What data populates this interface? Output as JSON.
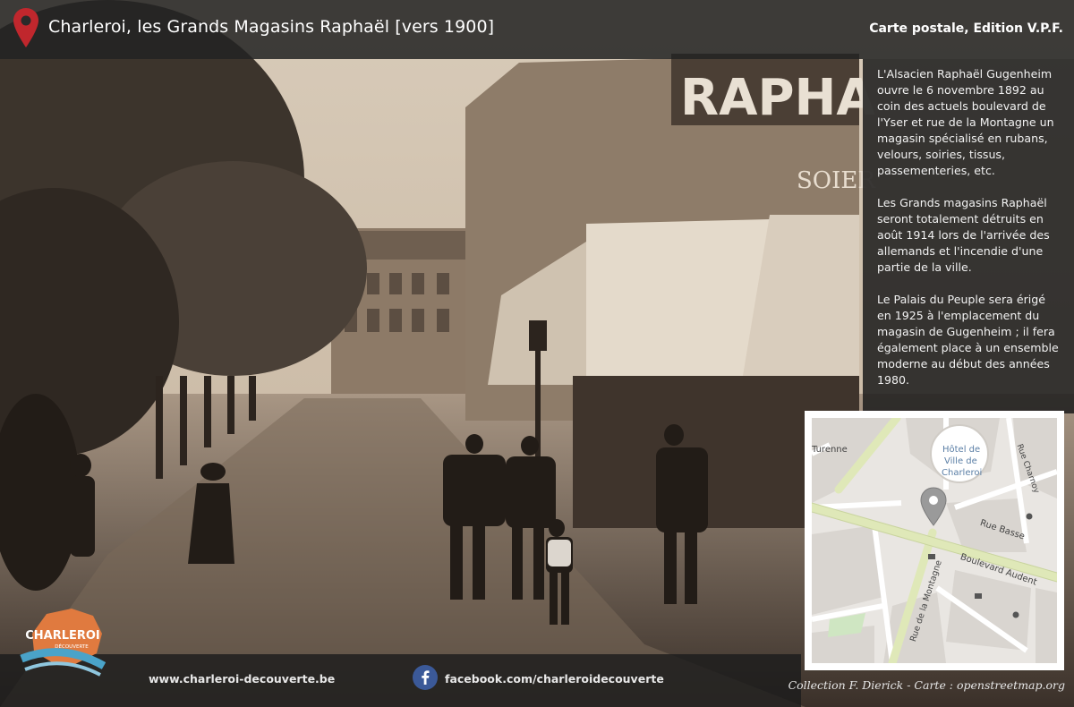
{
  "header": {
    "title": "Charleroi, les Grands Magasins Raphaël [vers 1900]",
    "credit": "Carte postale, Edition V.P.F."
  },
  "photo": {
    "shop_sign": "RAPHA",
    "awning_text": "SOIER"
  },
  "panel": {
    "paragraphs": [
      "L'Alsacien Raphaël Gugenheim ouvre le 6 novembre 1892 au coin des actuels boulevard de l'Yser et rue de la Montagne un magasin spécialisé en rubans, velours, soiries, tissus, passementeries, etc.",
      "Les Grands magasins Raphaël seront totalement détruits en août 1914 lors de l'arrivée des allemands et l'incendie d'une partie de la ville.",
      "Le Palais du Peuple sera érigé en 1925 à l'emplacement du magasin de Gugenheim ; il fera également place à un ensemble moderne au début des années 1980."
    ]
  },
  "map": {
    "labels": {
      "hotel_line1": "Hôtel de",
      "hotel_line2": "Ville de",
      "hotel_line3": "Charleroi",
      "turenne": "Turenne",
      "charnoy": "Rue Charnoy",
      "basse": "Rue Basse",
      "boulevard": "Boulevard Audent",
      "montagne": "Rue de la Montagne"
    },
    "colors": {
      "road_major": "#dfe8b8",
      "road_minor": "#ffffff",
      "block": "#d9d5d0",
      "park": "#cfe6c2"
    }
  },
  "logo": {
    "line1": "CHARLEROI",
    "line2": "DÉCOUVERTE"
  },
  "footer": {
    "site": "www.charleroi-decouverte.be",
    "facebook": "facebook.com/charleroidecouverte",
    "credit": "Collection F. Dierick - Carte : openstreetmap.org"
  },
  "colors": {
    "pin": "#c0272d",
    "facebook": "#3b5998",
    "logo_orange": "#e07a3f",
    "logo_blue": "#4aa3c9"
  }
}
